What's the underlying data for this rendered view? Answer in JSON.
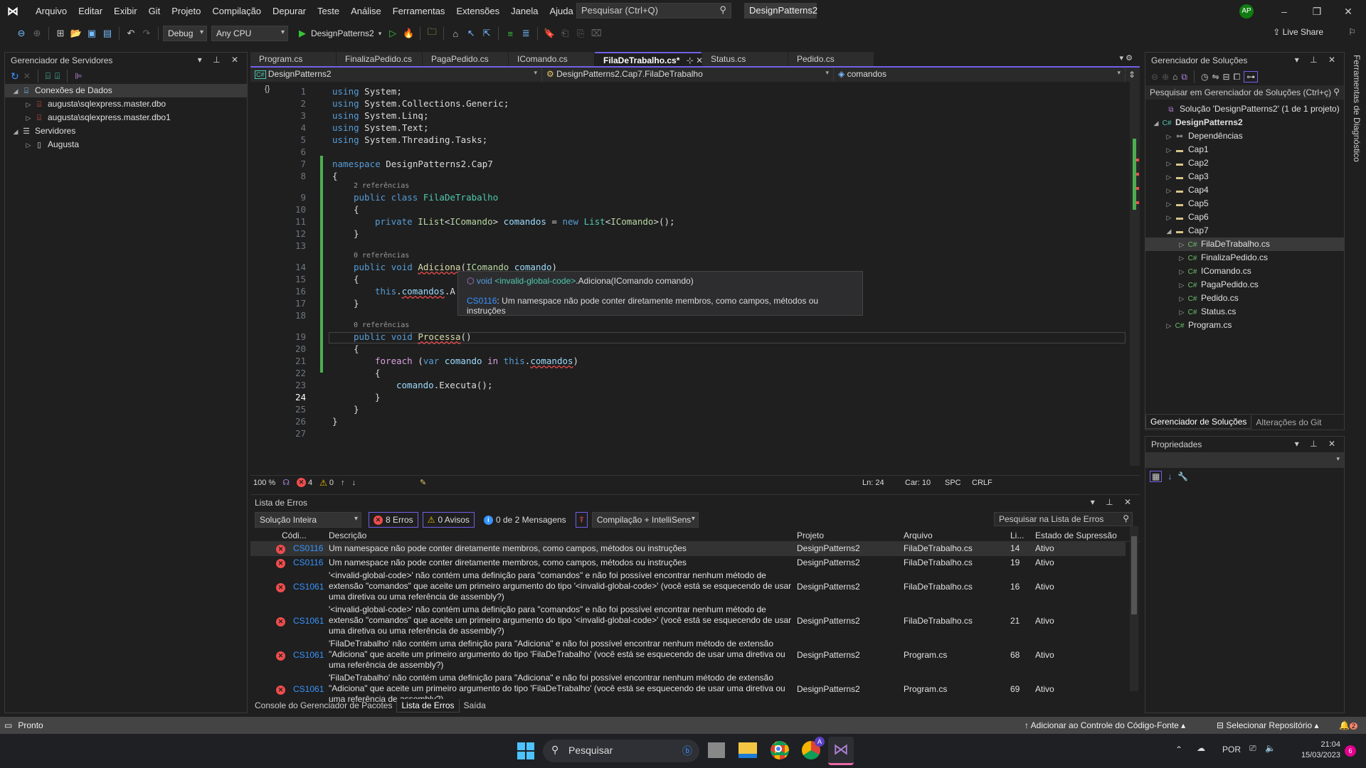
{
  "window": {
    "menu": [
      "Arquivo",
      "Editar",
      "Exibir",
      "Git",
      "Projeto",
      "Compilação",
      "Depurar",
      "Teste",
      "Análise",
      "Ferramentas",
      "Extensões",
      "Janela",
      "Ajuda"
    ],
    "search_placeholder": "Pesquisar (Ctrl+Q)",
    "solution_name": "DesignPatterns2",
    "avatar_initials": "AP",
    "live_share": "Live Share"
  },
  "toolbar": {
    "configuration": "Debug",
    "platform": "Any CPU",
    "start_target": "DesignPatterns2"
  },
  "server_explorer": {
    "title": "Gerenciador de Servidores",
    "items": [
      {
        "label": "Conexões de Dados",
        "level": 0,
        "expanded": true,
        "icon": "database-icon"
      },
      {
        "label": "augusta\\sqlexpress.master.dbo",
        "level": 1,
        "expanded": false,
        "icon": "db-connection-error-icon"
      },
      {
        "label": "augusta\\sqlexpress.master.dbo1",
        "level": 1,
        "expanded": false,
        "icon": "db-connection-error-icon"
      },
      {
        "label": "Servidores",
        "level": 0,
        "expanded": true,
        "icon": "servers-icon"
      },
      {
        "label": "Augusta",
        "level": 1,
        "expanded": false,
        "icon": "server-icon"
      }
    ]
  },
  "editor": {
    "tabs": [
      {
        "label": "Program.cs",
        "active": false
      },
      {
        "label": "FinalizaPedido.cs",
        "active": false
      },
      {
        "label": "PagaPedido.cs",
        "active": false
      },
      {
        "label": "IComando.cs",
        "active": false
      },
      {
        "label": "FilaDeTrabalho.cs*",
        "active": true
      },
      {
        "label": "Status.cs",
        "active": false
      },
      {
        "label": "Pedido.cs",
        "active": false
      }
    ],
    "nav_project": "DesignPatterns2",
    "nav_type": "DesignPatterns2.Cap7.FilaDeTrabalho",
    "nav_member": "comandos",
    "refs": {
      "class": "2 referências",
      "adiciona": "0 referências",
      "processa": "0 referências"
    },
    "current_line": 24,
    "tooltip": {
      "signature_prefix": "void ",
      "signature_scope": "<invalid-global-code>",
      "signature_rest": ".Adiciona(IComando comando)",
      "error_code": "CS0116",
      "error_text": ": Um namespace não pode conter diretamente membros, como campos, métodos ou instruções"
    },
    "status": {
      "zoom": "100 %",
      "errors": "4",
      "warnings": "0",
      "line": "Ln: 24",
      "col": "Car: 10",
      "indent": "SPC",
      "eol": "CRLF"
    }
  },
  "error_list": {
    "title": "Lista de Erros",
    "scope": "Solução Inteira",
    "errors_btn": "8 Erros",
    "warnings_btn": "0 Avisos",
    "messages_btn": "0 de 2 Mensagens",
    "source": "Compilação + IntelliSens",
    "search_placeholder": "Pesquisar na Lista de Erros",
    "columns": [
      "Códi...",
      "Descrição",
      "Projeto",
      "Arquivo",
      "Li...",
      "Estado de Supressão"
    ],
    "rows": [
      {
        "code": "CS0116",
        "desc": "Um namespace não pode conter diretamente membros, como campos, métodos ou instruções",
        "project": "DesignPatterns2",
        "file": "FilaDeTrabalho.cs",
        "line": "14",
        "state": "Ativo"
      },
      {
        "code": "CS0116",
        "desc": "Um namespace não pode conter diretamente membros, como campos, métodos ou instruções",
        "project": "DesignPatterns2",
        "file": "FilaDeTrabalho.cs",
        "line": "19",
        "state": "Ativo"
      },
      {
        "code": "CS1061",
        "desc": "'<invalid-global-code>' não contém uma definição para \"comandos\" e não foi possível encontrar nenhum método de extensão \"comandos\" que aceite um primeiro argumento do tipo '<invalid-global-code>' (você está se esquecendo de usar uma diretiva ou uma referência de assembly?)",
        "project": "DesignPatterns2",
        "file": "FilaDeTrabalho.cs",
        "line": "16",
        "state": "Ativo"
      },
      {
        "code": "CS1061",
        "desc": "'<invalid-global-code>' não contém uma definição para \"comandos\" e não foi possível encontrar nenhum método de extensão \"comandos\" que aceite um primeiro argumento do tipo '<invalid-global-code>' (você está se esquecendo de usar uma diretiva ou uma referência de assembly?)",
        "project": "DesignPatterns2",
        "file": "FilaDeTrabalho.cs",
        "line": "21",
        "state": "Ativo"
      },
      {
        "code": "CS1061",
        "desc": "'FilaDeTrabalho' não contém uma definição para \"Adiciona\" e não foi possível encontrar nenhum método de extensão \"Adiciona\" que aceite um primeiro argumento do tipo 'FilaDeTrabalho' (você está se esquecendo de usar uma diretiva ou uma referência de assembly?)",
        "project": "DesignPatterns2",
        "file": "Program.cs",
        "line": "68",
        "state": "Ativo"
      },
      {
        "code": "CS1061",
        "desc": "'FilaDeTrabalho' não contém uma definição para \"Adiciona\" e não foi possível encontrar nenhum método de extensão \"Adiciona\" que aceite um primeiro argumento do tipo 'FilaDeTrabalho' (você está se esquecendo de usar uma diretiva ou uma referência de assembly?)",
        "project": "DesignPatterns2",
        "file": "Program.cs",
        "line": "69",
        "state": "Ativo"
      }
    ],
    "bottom_tabs": [
      {
        "label": "Console do Gerenciador de Pacotes",
        "active": false
      },
      {
        "label": "Lista de Erros",
        "active": true
      },
      {
        "label": "Saída",
        "active": false
      }
    ]
  },
  "solution_explorer": {
    "title": "Gerenciador de Soluções",
    "search_placeholder": "Pesquisar em Gerenciador de Soluções (Ctrl+ç)",
    "items": [
      {
        "label": "Solução 'DesignPatterns2' (1 de 1 projeto)",
        "level": 0,
        "twisty": "",
        "icon": "solution-icon"
      },
      {
        "label": "DesignPatterns2",
        "level": 0,
        "twisty": "open",
        "icon": "csharp-project-icon",
        "bold": true
      },
      {
        "label": "Dependências",
        "level": 1,
        "twisty": "closed",
        "icon": "dependencies-icon"
      },
      {
        "label": "Cap1",
        "level": 1,
        "twisty": "closed",
        "icon": "folder-icon"
      },
      {
        "label": "Cap2",
        "level": 1,
        "twisty": "closed",
        "icon": "folder-icon"
      },
      {
        "label": "Cap3",
        "level": 1,
        "twisty": "closed",
        "icon": "folder-icon"
      },
      {
        "label": "Cap4",
        "level": 1,
        "twisty": "closed",
        "icon": "folder-icon"
      },
      {
        "label": "Cap5",
        "level": 1,
        "twisty": "closed",
        "icon": "folder-icon"
      },
      {
        "label": "Cap6",
        "level": 1,
        "twisty": "closed",
        "icon": "folder-icon"
      },
      {
        "label": "Cap7",
        "level": 1,
        "twisty": "open",
        "icon": "folder-icon"
      },
      {
        "label": "FilaDeTrabalho.cs",
        "level": 2,
        "twisty": "closed",
        "icon": "csharp-file-icon",
        "selected": true
      },
      {
        "label": "FinalizaPedido.cs",
        "level": 2,
        "twisty": "closed",
        "icon": "csharp-file-icon"
      },
      {
        "label": "IComando.cs",
        "level": 2,
        "twisty": "closed",
        "icon": "csharp-file-icon"
      },
      {
        "label": "PagaPedido.cs",
        "level": 2,
        "twisty": "closed",
        "icon": "csharp-file-icon"
      },
      {
        "label": "Pedido.cs",
        "level": 2,
        "twisty": "closed",
        "icon": "csharp-file-icon"
      },
      {
        "label": "Status.cs",
        "level": 2,
        "twisty": "closed",
        "icon": "csharp-file-icon"
      },
      {
        "label": "Program.cs",
        "level": 1,
        "twisty": "closed",
        "icon": "csharp-file-icon"
      }
    ],
    "bottom_tabs": [
      {
        "label": "Gerenciador de Soluções",
        "active": true
      },
      {
        "label": "Alterações do Git",
        "active": false
      }
    ]
  },
  "properties": {
    "title": "Propriedades"
  },
  "side_tab": "Ferramentas de Diagnóstico",
  "statusbar": {
    "state": "Pronto",
    "source_control": "Adicionar ao Controle do Código-Fonte",
    "repository": "Selecionar Repositório",
    "notifications": "2"
  },
  "taskbar": {
    "search": "Pesquisar",
    "language": "POR",
    "time": "21:04",
    "date": "15/03/2023",
    "badge": "6",
    "chrome_profile": "A"
  }
}
